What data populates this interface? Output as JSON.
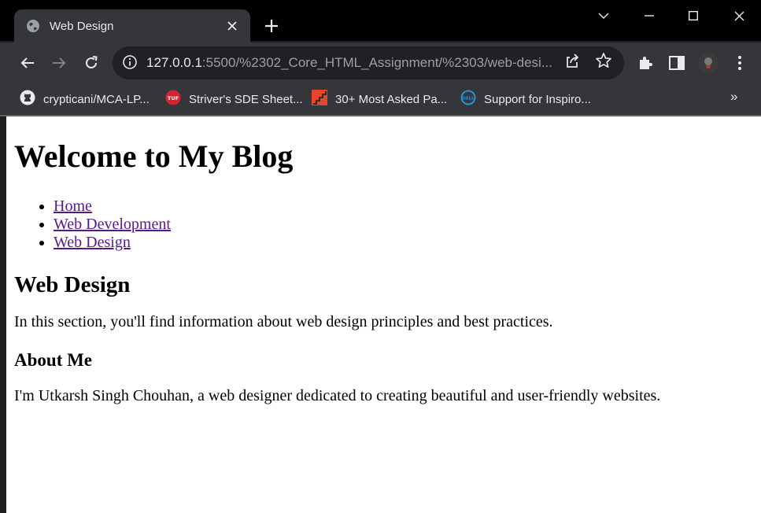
{
  "browser": {
    "tab": {
      "title": "Web Design"
    },
    "url": {
      "host": "127.0.0.1",
      "rest": ":5500/%2302_Core_HTML_Assignment/%2303/web-desi..."
    },
    "bookmarks": [
      {
        "label": "crypticani/MCA-LP...",
        "icon": "github-icon"
      },
      {
        "label": "Striver's SDE Sheet...",
        "icon": "tuf-icon"
      },
      {
        "label": "30+ Most Asked Pa...",
        "icon": "stairs-icon"
      },
      {
        "label": "Support for Inspiro...",
        "icon": "dell-icon"
      }
    ],
    "bookmarks_more": "»",
    "colors": {
      "tabstrip": "#000000",
      "toolbar": "#35363a",
      "omnibox": "#202124",
      "text": "#e8eaed"
    }
  },
  "page": {
    "h1": "Welcome to My Blog",
    "nav": [
      {
        "label": "Home"
      },
      {
        "label": "Web Development"
      },
      {
        "label": "Web Design"
      }
    ],
    "section_title": "Web Design",
    "section_text": "In this section, you'll find information about web design principles and best practices.",
    "about_title": "About Me",
    "about_text": "I'm Utkarsh Singh Chouhan, a web designer dedicated to creating beautiful and user-friendly websites.",
    "link_color": "#551a8b"
  }
}
